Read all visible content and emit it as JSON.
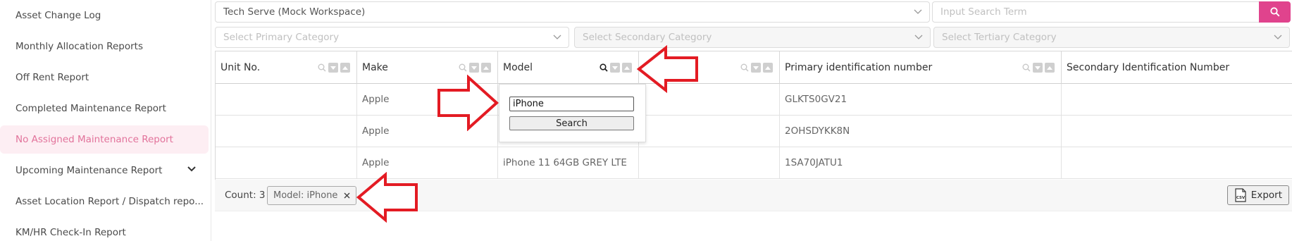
{
  "sidebar": {
    "items": [
      {
        "label": "Asset Change Log"
      },
      {
        "label": "Monthly Allocation Reports"
      },
      {
        "label": "Off Rent Report"
      },
      {
        "label": "Completed Maintenance Report"
      },
      {
        "label": "No Assigned Maintenance Report"
      },
      {
        "label": "Upcoming Maintenance Report"
      },
      {
        "label": "Asset Location Report / Dispatch repo..."
      },
      {
        "label": "KM/HR Check-In Report"
      }
    ]
  },
  "filters": {
    "workspace": "Tech Serve (Mock Workspace)",
    "search_placeholder": "Input Search Term",
    "primary_category": "Select Primary Category",
    "secondary_category": "Select Secondary Category",
    "tertiary_category": "Select Tertiary Category"
  },
  "table": {
    "columns": [
      {
        "label": "Unit No."
      },
      {
        "label": "Make"
      },
      {
        "label": "Model"
      },
      {
        "label": ""
      },
      {
        "label": "Primary identification number"
      },
      {
        "label": "Secondary Identification Number"
      }
    ],
    "rows": [
      {
        "unit": "",
        "make": "Apple",
        "model": "",
        "col4": "",
        "primary_id": "GLKTS0GV21",
        "secondary_id": ""
      },
      {
        "unit": "",
        "make": "Apple",
        "model": "",
        "col4": "",
        "primary_id": "2OHSDYKK8N",
        "secondary_id": ""
      },
      {
        "unit": "",
        "make": "Apple",
        "model": "iPhone 11 64GB GREY LTE",
        "col4": "",
        "primary_id": "1SA70JATU1",
        "secondary_id": ""
      }
    ]
  },
  "footer": {
    "count_label": "Count: 3",
    "filter_chip": "Model: iPhone",
    "export_label": "Export",
    "csv_icon_text": "CSV"
  },
  "popup": {
    "input_value": "iPhone",
    "button_label": "Search"
  },
  "colors": {
    "accent": "#e0438d",
    "active_bg": "#fdeef3",
    "active_text": "#e2739b",
    "annotation_arrow": "#e31b23"
  }
}
